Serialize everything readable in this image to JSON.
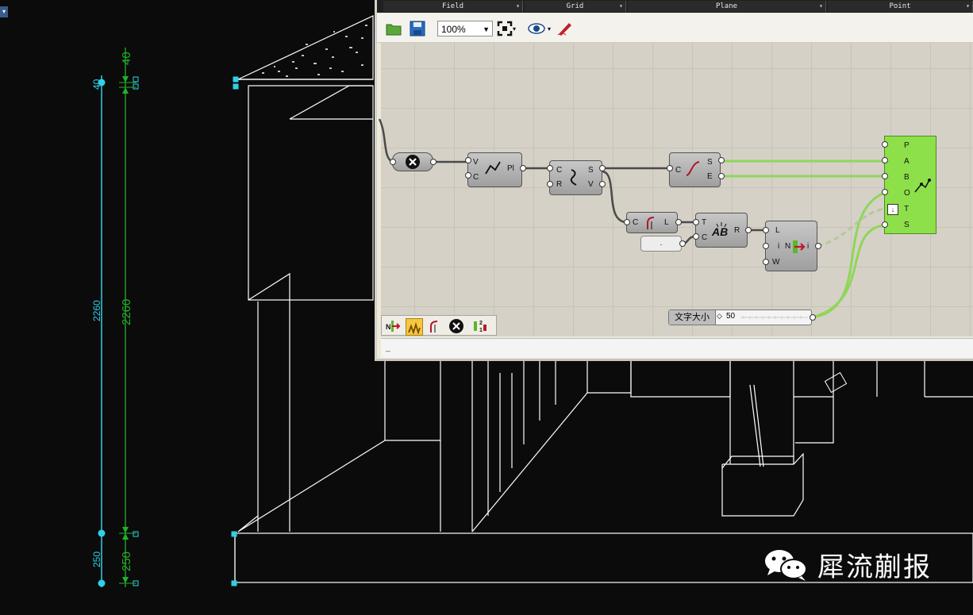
{
  "cad": {
    "dims_cyan": [
      "40",
      "2260",
      "250"
    ],
    "dims_green": [
      "40",
      "2260",
      "250"
    ]
  },
  "gh": {
    "tabs": [
      "Field",
      "Grid",
      "Plane",
      "Point"
    ],
    "zoom": "100%",
    "status": "_",
    "components": {
      "polyline": {
        "inputs": [
          "V",
          "C"
        ],
        "outputs": [
          "Pl"
        ]
      },
      "shatter": {
        "inputs": [
          "C",
          "R"
        ],
        "outputs": [
          "S",
          "V"
        ]
      },
      "endpoints": {
        "inputs": [
          "C"
        ],
        "outputs": [
          "S",
          "E"
        ]
      },
      "length": {
        "inputs": [
          "C"
        ],
        "outputs": [
          "L"
        ]
      },
      "panel_dot": ".",
      "concat": {
        "inputs": [
          "T",
          "C"
        ],
        "outputs": [
          "R"
        ]
      },
      "number_item": {
        "inputs": [
          "L",
          "i",
          "W"
        ],
        "middle": "N",
        "outputs": [
          "i"
        ]
      },
      "text_tag": {
        "inputs": [
          "P",
          "A",
          "B",
          "O",
          "T",
          "S"
        ]
      }
    },
    "slider": {
      "label": "文字大小",
      "value": "50"
    },
    "accent_green": "#8ee04a"
  },
  "watermark": {
    "text": "犀流蒯报"
  }
}
